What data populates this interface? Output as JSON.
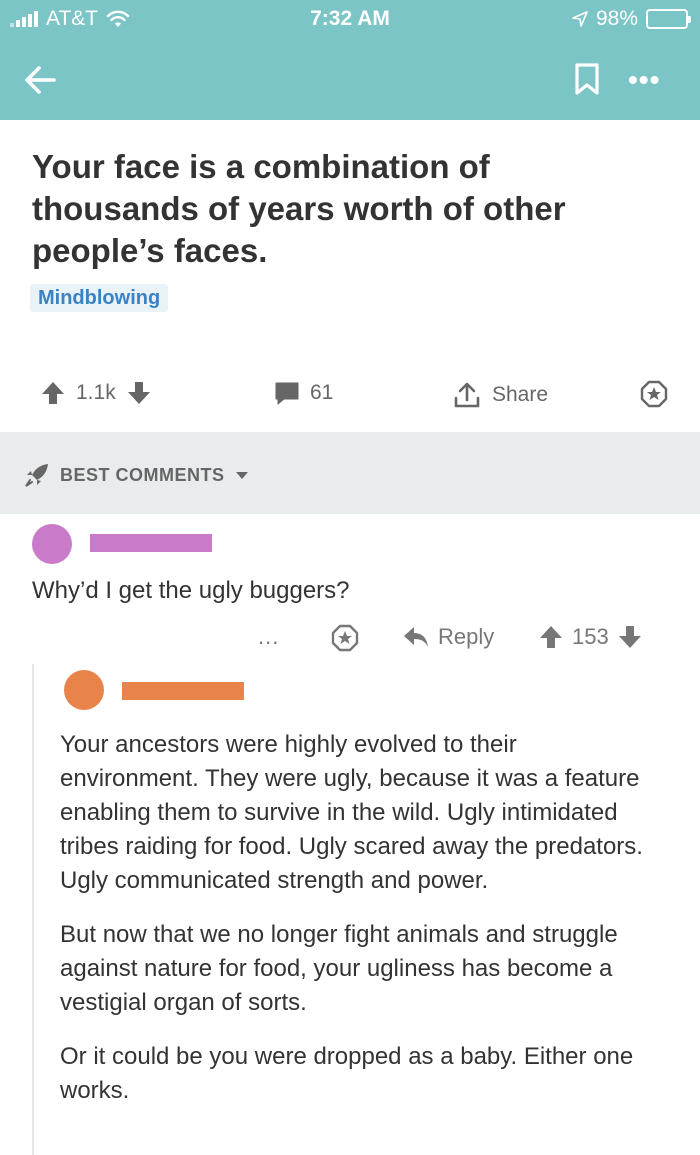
{
  "status": {
    "carrier": "AT&T",
    "time": "7:32 AM",
    "battery": "98%"
  },
  "post": {
    "title": "Your face is a combination of thousands of years worth of other people’s faces.",
    "flair": "Mindblowing",
    "votes": "1.1k",
    "comments": "61",
    "share_label": "Share"
  },
  "sort": {
    "label": "BEST COMMENTS"
  },
  "comments": [
    {
      "text": "Why’d I get the ugly buggers?",
      "reply_label": "Reply",
      "votes": "153",
      "more": "...",
      "avatar_color": "#c97ac9",
      "name_color": "#c97ac9"
    },
    {
      "paragraphs": [
        "Your ancestors were highly evolved to their environment. They were ugly, because it was a feature enabling them to survive in the wild. Ugly intimidated tribes raiding for food. Ugly scared away the predators. Ugly communicated strength and power.",
        "But now that we no longer fight animals and struggle against nature for food, your ugliness has become a vestigial organ of sorts.",
        "Or it could be you were dropped as a baby. Either one works."
      ],
      "avatar_color": "#e8834a",
      "name_color": "#e8834a"
    }
  ],
  "colors": {
    "header": "#7cc5c6",
    "flair_text": "#3a82c4",
    "sort_bg": "#e9eced"
  }
}
